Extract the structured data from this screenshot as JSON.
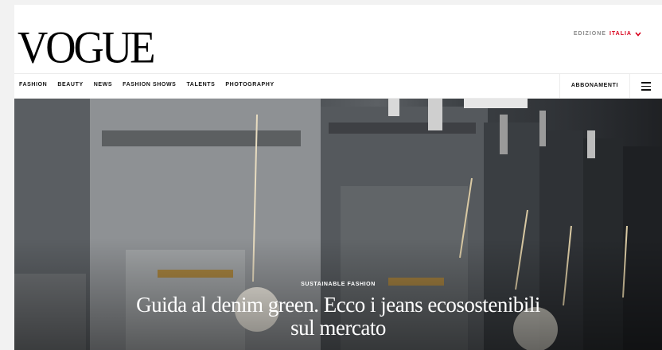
{
  "header": {
    "logo": "VOGUE",
    "edition_label": "EDIZIONE",
    "edition_country": "ITALIA"
  },
  "nav": {
    "items": [
      "FASHION",
      "BEAUTY",
      "NEWS",
      "FASHION SHOWS",
      "TALENTS",
      "PHOTOGRAPHY"
    ],
    "subscribe": "ABBONAMENTI"
  },
  "hero": {
    "kicker": "SUSTAINABLE FASHION",
    "headline_line1": "Guida al denim green. Ecco i jeans ecosostenibili",
    "headline_line2": "sul mercato"
  },
  "icons": {
    "edition_chevron": "chevron-down-icon",
    "menu": "hamburger-menu-icon"
  },
  "colors": {
    "accent": "#d9001b",
    "text": "#111111",
    "muted": "#8a8a8a"
  }
}
